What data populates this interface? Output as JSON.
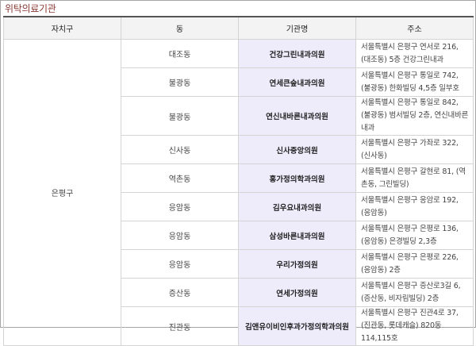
{
  "title": "위탁의료기관",
  "headers": [
    "자치구",
    "동",
    "기관명",
    "주소"
  ],
  "district": "은평구",
  "rows": [
    {
      "dong": "대조동",
      "name": "건강그린내과의원",
      "address": "서울특별시 은평구 연서로 216, (대조동) 5층 건강그린내과"
    },
    {
      "dong": "불광동",
      "name": "연세큰숲내과의원",
      "address": "서울특별시 은평구 통일로 742, (불광동) 한화빌딩 4,5층 일부호"
    },
    {
      "dong": "불광동",
      "name": "연신내바른내과의원",
      "address": "서울특별시 은평구 통일로 842, (불광동) 범서빌딩 2층, 연신내바른내과"
    },
    {
      "dong": "신사동",
      "name": "신사중앙의원",
      "address": "서울특별시 은평구 가좌로 322, (신사동)"
    },
    {
      "dong": "역촌동",
      "name": "홍가정의학과의원",
      "address": "서울특별시 은평구 갈현로 81, (역촌동, 그린빌딩)"
    },
    {
      "dong": "응암동",
      "name": "김우요내과의원",
      "address": "서울특별시 은평구 응암로 192, (응암동)"
    },
    {
      "dong": "응암동",
      "name": "삼성바른내과의원",
      "address": "서울특별시 은평구 은평로 136, (응암동) 은경빌딩 2,3층"
    },
    {
      "dong": "응암동",
      "name": "우리가정의원",
      "address": "서울특별시 은평구 은평로 226, (응암동) 2층"
    },
    {
      "dong": "증산동",
      "name": "연세가정의원",
      "address": "서울특별시 은평구 증산로3길 6, (증산동, 비자림빌딩) 2층"
    },
    {
      "dong": "진관동",
      "name": "김앤유이비인후과가정의학과의원",
      "address": "서울특별시 은평구 진관4로 37, (진관동, 롯데캐슬) 820동 114,115호"
    }
  ]
}
